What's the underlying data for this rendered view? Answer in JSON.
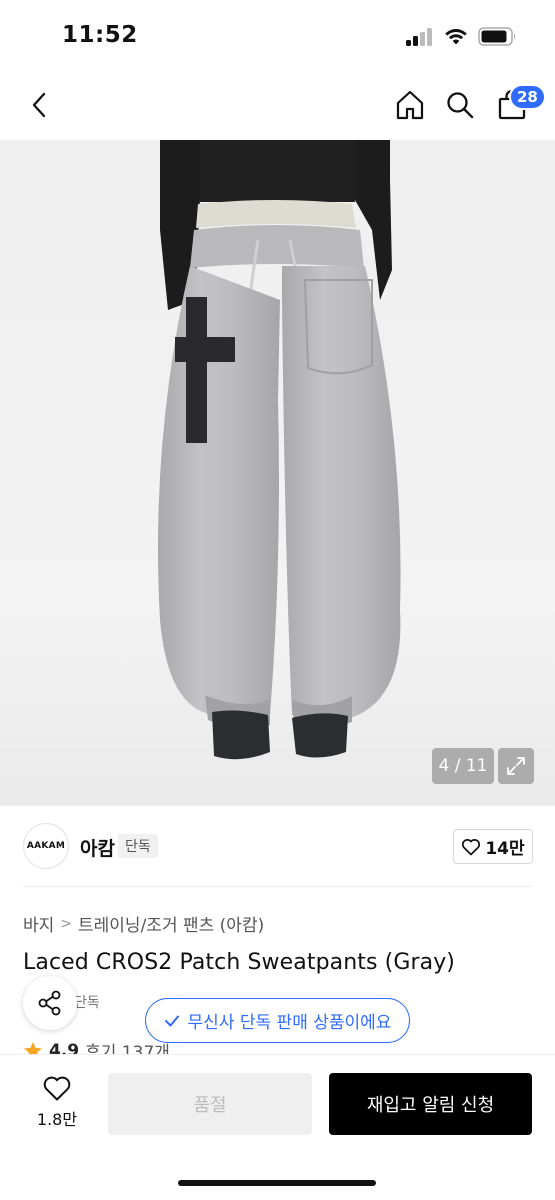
{
  "status_bar": {
    "time": "11:52"
  },
  "nav": {
    "cart_count": "28"
  },
  "gallery": {
    "counter": "4 / 11",
    "current_index": 4,
    "total": 11
  },
  "brand": {
    "logo_text": "AAKAM",
    "name": "아캄",
    "exclusive_label": "단독",
    "likes": "14만"
  },
  "breadcrumb": {
    "category": "바지",
    "subcategory": "트레이닝/조거 팬츠 (아캄)"
  },
  "product": {
    "title": "Laced CROS2 Patch Sweatpants (Gray)",
    "sub_tag": "단독",
    "rating": "4.9",
    "reviews": "후기 137개"
  },
  "toast": {
    "text": "무신사 단독 판매 상품이에요"
  },
  "bottom_bar": {
    "wish_count": "1.8만",
    "soldout_label": "품절",
    "restock_label": "재입고 알림 신청"
  },
  "colors": {
    "accent": "#2f6bff",
    "primary_button": "#000000",
    "disabled_button": "#efefef",
    "star": "#f5a623"
  }
}
